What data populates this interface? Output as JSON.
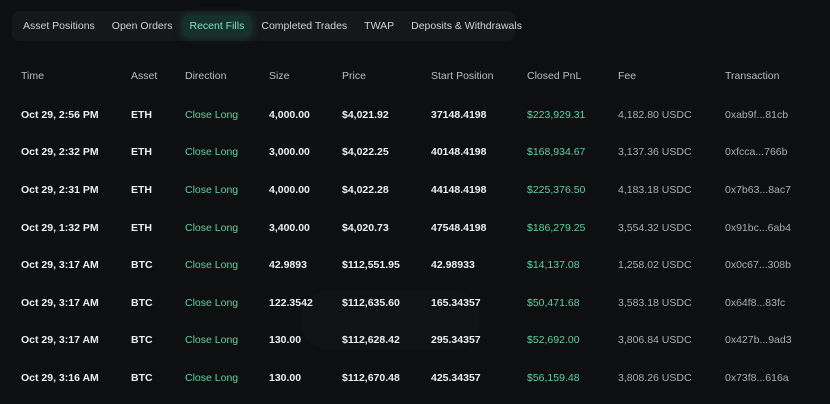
{
  "tabs": [
    {
      "label": "Asset Positions",
      "active": false
    },
    {
      "label": "Open Orders",
      "active": false
    },
    {
      "label": "Recent Fills",
      "active": true
    },
    {
      "label": "Completed Trades",
      "active": false
    },
    {
      "label": "TWAP",
      "active": false
    },
    {
      "label": "Deposits & Withdrawals",
      "active": false
    }
  ],
  "columns": [
    "Time",
    "Asset",
    "Direction",
    "Size",
    "Price",
    "Start Position",
    "Closed PnL",
    "Fee",
    "Transaction"
  ],
  "rows": [
    {
      "time": "Oct 29, 2:56 PM",
      "asset": "ETH",
      "direction": "Close Long",
      "size": "4,000.00",
      "price": "$4,021.92",
      "start_position": "37148.4198",
      "closed_pnl": "$223,929.31",
      "fee": "4,182.80 USDC",
      "transaction": "0xab9f...81cb"
    },
    {
      "time": "Oct 29, 2:32 PM",
      "asset": "ETH",
      "direction": "Close Long",
      "size": "3,000.00",
      "price": "$4,022.25",
      "start_position": "40148.4198",
      "closed_pnl": "$168,934.67",
      "fee": "3,137.36 USDC",
      "transaction": "0xfcca...766b"
    },
    {
      "time": "Oct 29, 2:31 PM",
      "asset": "ETH",
      "direction": "Close Long",
      "size": "4,000.00",
      "price": "$4,022.28",
      "start_position": "44148.4198",
      "closed_pnl": "$225,376.50",
      "fee": "4,183.18 USDC",
      "transaction": "0x7b63...8ac7"
    },
    {
      "time": "Oct 29, 1:32 PM",
      "asset": "ETH",
      "direction": "Close Long",
      "size": "3,400.00",
      "price": "$4,020.73",
      "start_position": "47548.4198",
      "closed_pnl": "$186,279.25",
      "fee": "3,554.32 USDC",
      "transaction": "0x91bc...6ab4"
    },
    {
      "time": "Oct 29, 3:17 AM",
      "asset": "BTC",
      "direction": "Close Long",
      "size": "42.9893",
      "price": "$112,551.95",
      "start_position": "42.98933",
      "closed_pnl": "$14,137.08",
      "fee": "1,258.02 USDC",
      "transaction": "0x0c67...308b"
    },
    {
      "time": "Oct 29, 3:17 AM",
      "asset": "BTC",
      "direction": "Close Long",
      "size": "122.3542",
      "price": "$112,635.60",
      "start_position": "165.34357",
      "closed_pnl": "$50,471.68",
      "fee": "3,583.18 USDC",
      "transaction": "0x64f8...83fc"
    },
    {
      "time": "Oct 29, 3:17 AM",
      "asset": "BTC",
      "direction": "Close Long",
      "size": "130.00",
      "price": "$112,628.42",
      "start_position": "295.34357",
      "closed_pnl": "$52,692.00",
      "fee": "3,806.84 USDC",
      "transaction": "0x427b...9ad3"
    },
    {
      "time": "Oct 29, 3:16 AM",
      "asset": "BTC",
      "direction": "Close Long",
      "size": "130.00",
      "price": "$112,670.48",
      "start_position": "425.34357",
      "closed_pnl": "$56,159.48",
      "fee": "3,808.26 USDC",
      "transaction": "0x73f8...616a"
    }
  ],
  "colors": {
    "background": "#0e0f10",
    "tab_bar": "#15171a",
    "active_tab_text": "#7ee0bd",
    "positive": "#5fd3a2",
    "muted_text": "#a9adb1"
  }
}
